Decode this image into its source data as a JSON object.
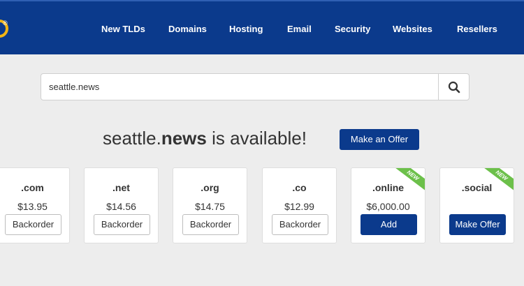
{
  "header": {
    "nav": [
      "New TLDs",
      "Domains",
      "Hosting",
      "Email",
      "Security",
      "Websites",
      "Resellers"
    ]
  },
  "search": {
    "value": "seattle.news",
    "icon": "search-icon"
  },
  "result": {
    "domain_name": "seattle.",
    "domain_tld": "news",
    "status_text": "is available!",
    "offer_button": "Make an Offer"
  },
  "cards": [
    {
      "tld": ".com",
      "price": "$13.95",
      "button": "Backorder"
    },
    {
      "tld": ".net",
      "price": "$14.56",
      "button": "Backorder"
    },
    {
      "tld": ".org",
      "price": "$14.75",
      "button": "Backorder"
    },
    {
      "tld": ".co",
      "price": "$12.99",
      "button": "Backorder"
    },
    {
      "tld": ".online",
      "price": "$6,000.00",
      "button": "Add",
      "badge": "NEW"
    },
    {
      "tld": ".social",
      "price": "",
      "button": "Make Offer",
      "badge": "NEW"
    }
  ],
  "colors": {
    "brand": "#0b3a8c",
    "accent": "#6cc04a",
    "logo": "#f2b515"
  }
}
